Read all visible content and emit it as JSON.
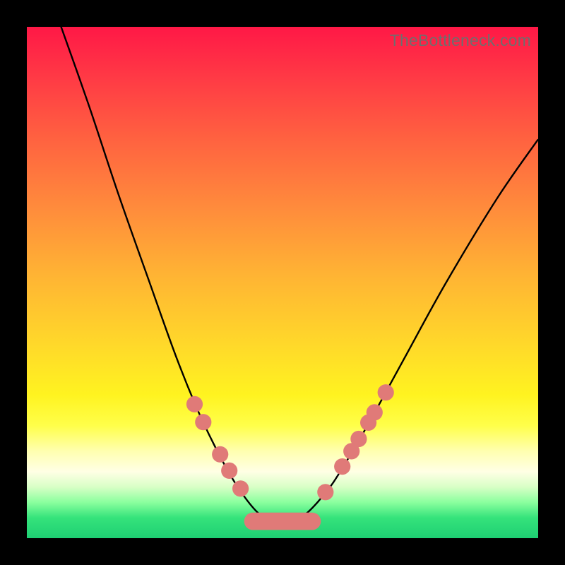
{
  "watermark": "TheBottleneck.com",
  "colors": {
    "frame": "#000000",
    "curve": "#000000",
    "bead": "#e07a78",
    "gradient_top": "#ff1846",
    "gradient_bottom": "#1ecf73"
  },
  "chart_data": {
    "type": "line",
    "title": "",
    "xlabel": "",
    "ylabel": "",
    "xlim": [
      0,
      100
    ],
    "ylim": [
      0,
      100
    ],
    "grid": false,
    "series": [
      {
        "name": "bottleneck-curve",
        "comment": "x,y as percent of plot area; y=0 top, y=100 bottom",
        "points": [
          {
            "x": 6.0,
            "y": -2.0
          },
          {
            "x": 12.0,
            "y": 15.0
          },
          {
            "x": 18.0,
            "y": 33.0
          },
          {
            "x": 24.0,
            "y": 50.0
          },
          {
            "x": 29.0,
            "y": 64.0
          },
          {
            "x": 33.0,
            "y": 74.0
          },
          {
            "x": 36.5,
            "y": 81.5
          },
          {
            "x": 40.0,
            "y": 88.0
          },
          {
            "x": 43.0,
            "y": 92.5
          },
          {
            "x": 45.5,
            "y": 95.3
          },
          {
            "x": 48.0,
            "y": 96.6
          },
          {
            "x": 50.0,
            "y": 97.0
          },
          {
            "x": 52.0,
            "y": 96.6
          },
          {
            "x": 54.5,
            "y": 95.3
          },
          {
            "x": 57.0,
            "y": 92.8
          },
          {
            "x": 60.0,
            "y": 89.0
          },
          {
            "x": 64.0,
            "y": 82.5
          },
          {
            "x": 68.0,
            "y": 75.5
          },
          {
            "x": 74.0,
            "y": 64.5
          },
          {
            "x": 82.0,
            "y": 50.0
          },
          {
            "x": 92.0,
            "y": 33.5
          },
          {
            "x": 100.0,
            "y": 22.0
          }
        ]
      }
    ],
    "beads_left": [
      {
        "x": 32.8,
        "y": 73.8,
        "r": 1.6
      },
      {
        "x": 34.5,
        "y": 77.3,
        "r": 1.6
      },
      {
        "x": 37.8,
        "y": 83.6,
        "r": 1.6
      },
      {
        "x": 39.6,
        "y": 86.8,
        "r": 1.6
      },
      {
        "x": 41.8,
        "y": 90.3,
        "r": 1.6
      }
    ],
    "beads_right": [
      {
        "x": 58.4,
        "y": 91.0,
        "r": 1.6
      },
      {
        "x": 61.7,
        "y": 86.0,
        "r": 1.6
      },
      {
        "x": 63.5,
        "y": 83.0,
        "r": 1.6
      },
      {
        "x": 64.9,
        "y": 80.6,
        "r": 1.6
      },
      {
        "x": 66.8,
        "y": 77.4,
        "r": 1.6
      },
      {
        "x": 68.0,
        "y": 75.4,
        "r": 1.6
      },
      {
        "x": 70.2,
        "y": 71.5,
        "r": 1.6
      }
    ],
    "pill": {
      "x1": 44.2,
      "x2": 55.8,
      "y": 96.7,
      "r": 1.7
    }
  }
}
